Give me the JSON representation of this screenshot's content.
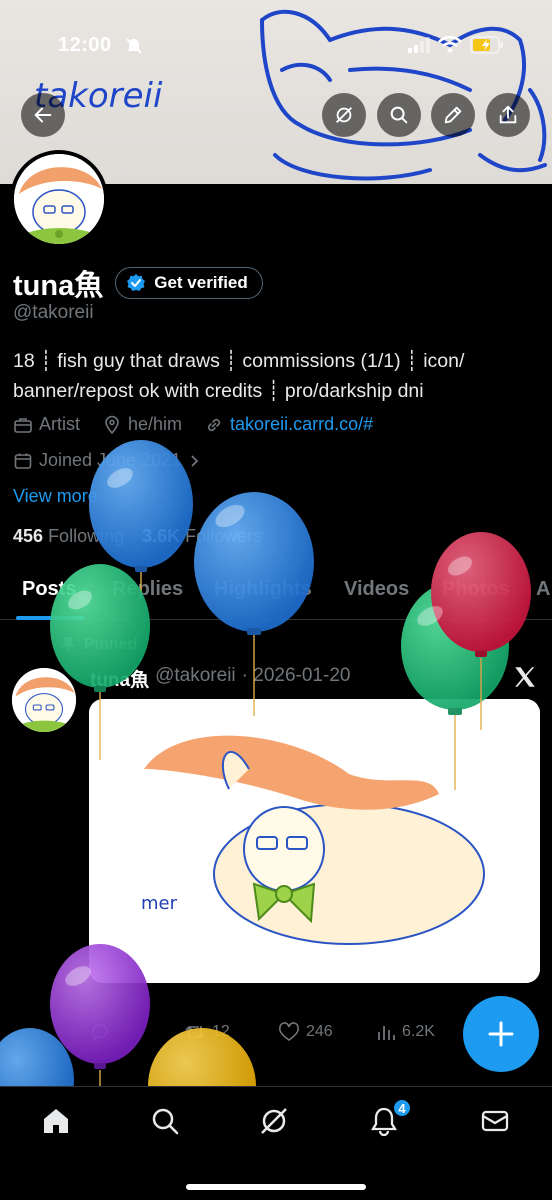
{
  "status_bar": {
    "time": "12:00"
  },
  "banner": {
    "scribble_text": "takoreii"
  },
  "profile": {
    "display_name": "tuna魚",
    "verify_label": "Get verified",
    "handle": "@takoreii",
    "bio_line1": "18 ┊ fish guy that draws ┊ commissions (1/1) ┊ icon/",
    "bio_line2": "banner/repost ok with credits ┊ pro/darkship dni",
    "category": "Artist",
    "location": "he/him",
    "link": "takoreii.carrd.co/#",
    "joined": "Joined June 2021",
    "view_more": "View more",
    "following_count": "456",
    "following_label": "Following",
    "followers_count": "3.6K",
    "followers_label": "Followers"
  },
  "tabs": [
    "Posts",
    "Replies",
    "Highlights",
    "Videos",
    "Photos",
    "A"
  ],
  "post": {
    "pinned_label": "Pinned",
    "author": "tuna魚",
    "handle": "@takoreii",
    "date": "· 2026-01-20",
    "image_caption": "mer",
    "retweets": "12",
    "likes": "246",
    "views": "6.2K"
  },
  "nav": {
    "notification_badge": "4"
  },
  "colors": {
    "accent": "#1d9bf0",
    "background": "#000000",
    "muted": "#71767b"
  }
}
